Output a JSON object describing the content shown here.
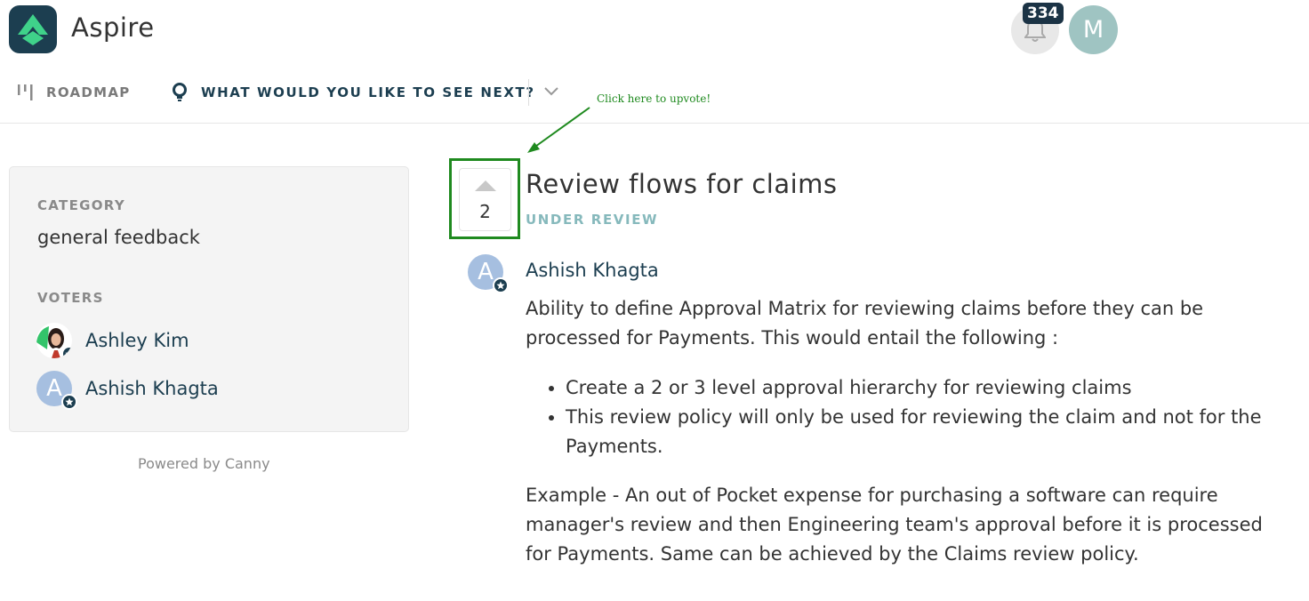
{
  "header": {
    "app_title": "Aspire",
    "notification_count": "334",
    "user_initial": "M",
    "icons": [
      "logo-icon",
      "bell-icon"
    ]
  },
  "nav": {
    "roadmap_label": "ROADMAP",
    "board_label": "WHAT WOULD YOU LIKE TO SEE NEXT?",
    "icons": [
      "roadmap-icon",
      "lightbulb-icon",
      "chevron-down-icon"
    ]
  },
  "annotation": {
    "text": "Click here to upvote!",
    "color": "#1f8a1f"
  },
  "sidebar": {
    "category_label": "CATEGORY",
    "category_value": "general feedback",
    "voters_label": "VOTERS",
    "voters": [
      {
        "name": "Ashley Kim",
        "initial": ""
      },
      {
        "name": "Ashish Khagta",
        "initial": "A"
      }
    ],
    "powered_by": "Powered by Canny"
  },
  "post": {
    "vote_count": "2",
    "title": "Review flows for claims",
    "status": "UNDER REVIEW",
    "author": {
      "name": "Ashish Khagta",
      "initial": "A"
    },
    "intro": "Ability to define Approval Matrix for reviewing claims before they can be processed for Payments. This would entail the following :",
    "bullets": [
      "Create a 2 or 3 level approval hierarchy for reviewing claims",
      "This review policy will only be used for reviewing the claim and not for the Payments."
    ],
    "example": "Example - An out of Pocket expense for purchasing a software can require manager's review and then Engineering team's approval before it is processed for Payments. Same can be achieved by the Claims review policy."
  },
  "colors": {
    "brand_dark": "#1c3e50",
    "brand_green": "#3fd28a",
    "status": "#86b9bc",
    "user_avatar": "#9fc4c2"
  }
}
